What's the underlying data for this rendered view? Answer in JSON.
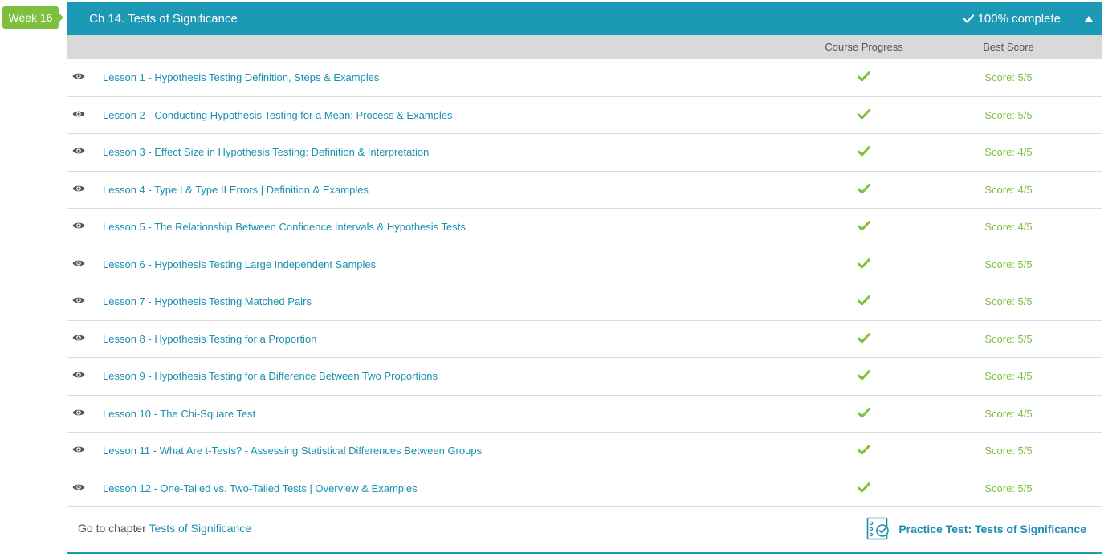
{
  "week": {
    "label": "Week 16"
  },
  "chapter": {
    "title": "Ch 14. Tests of Significance",
    "complete_label": "100% complete"
  },
  "columns": {
    "progress": "Course Progress",
    "score": "Best Score"
  },
  "lessons": [
    {
      "title": "Lesson 1 - Hypothesis Testing Definition, Steps & Examples",
      "score": "Score: 5/5"
    },
    {
      "title": "Lesson 2 - Conducting Hypothesis Testing for a Mean: Process & Examples",
      "score": "Score: 5/5"
    },
    {
      "title": "Lesson 3 - Effect Size in Hypothesis Testing: Definition & Interpretation",
      "score": "Score: 4/5"
    },
    {
      "title": "Lesson 4 - Type I & Type II Errors | Definition & Examples",
      "score": "Score: 4/5"
    },
    {
      "title": "Lesson 5 - The Relationship Between Confidence Intervals & Hypothesis Tests",
      "score": "Score: 4/5"
    },
    {
      "title": "Lesson 6 - Hypothesis Testing Large Independent Samples",
      "score": "Score: 5/5"
    },
    {
      "title": "Lesson 7 - Hypothesis Testing Matched Pairs",
      "score": "Score: 5/5"
    },
    {
      "title": "Lesson 8 - Hypothesis Testing for a Proportion",
      "score": "Score: 5/5"
    },
    {
      "title": "Lesson 9 - Hypothesis Testing for a Difference Between Two Proportions",
      "score": "Score: 4/5"
    },
    {
      "title": "Lesson 10 - The Chi-Square Test",
      "score": "Score: 4/5"
    },
    {
      "title": "Lesson 11 - What Are t-Tests? - Assessing Statistical Differences Between Groups",
      "score": "Score: 5/5"
    },
    {
      "title": "Lesson 12 - One-Tailed vs. Two-Tailed Tests | Overview & Examples",
      "score": "Score: 5/5"
    }
  ],
  "footer": {
    "goto_prefix": "Go to chapter",
    "goto_link": "Tests of Significance",
    "practice_test": "Practice Test: Tests of Significance"
  },
  "colors": {
    "header": "#1c99b4",
    "accent_green": "#7fbf3f",
    "link": "#1a8fb0",
    "column_header_bg": "#d9d9d9"
  },
  "icons": {
    "lesson_view": "eye-icon",
    "progress": "checkmark-icon",
    "collapse": "caret-up-icon",
    "practice": "checklist-icon"
  }
}
